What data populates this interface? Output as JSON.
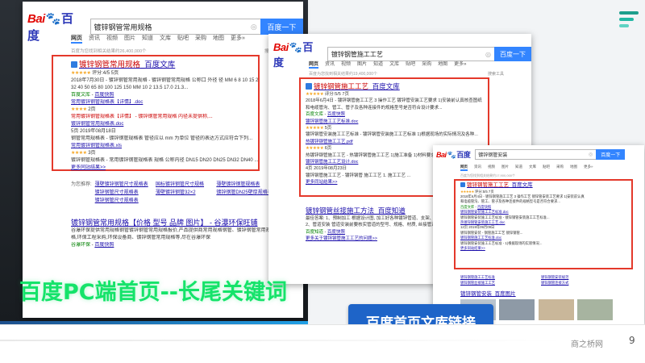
{
  "slide": {
    "caption_main": "百度PC端首页--长尾关键词",
    "caption_button": "百度首页文库链接",
    "footer_brand": "商之桥网",
    "page_number": "9",
    "colors": {
      "accent_green": "#15e36a",
      "accent_blue": "#1e64c8",
      "highlight_red": "#e4392b",
      "baidu_blue": "#3385ff"
    }
  },
  "baidu": {
    "logo_left": "Bai",
    "logo_paw": "🐾",
    "logo_right": "百度",
    "search_button": "百度一下",
    "camera_icon": "camera-icon",
    "tabs": [
      "网页",
      "资讯",
      "视频",
      "图片",
      "知道",
      "文库",
      "贴吧",
      "采购",
      "地图",
      "更多»"
    ],
    "search_tools": "搜索工具"
  },
  "panel1": {
    "query": "镀锌钢管常用规格",
    "result_count": "百度为您找到相关结果约26,400,000个",
    "r1": {
      "title_kw": "镀锌钢管常用规格",
      "title_suffix": "_百度文库",
      "rating": "评分:4/5 5页",
      "desc1": "2018年7月30日 - 镀锌钢管常用规格 - 镀锌钢管常用规格 公称口 外径 径 MM 6 8 10 15 20 25",
      "desc2": "32 40 50 65 80 100 125 150 MM 10 2 13.5 17.0 21.3...",
      "source": "百度文库",
      "snapshot": "百度快照",
      "sub1": "常用镀锌钢管规格表【详情】.doc",
      "sub1_meta": "2页",
      "sub1_desc": "常用镀锌钢管规格表【详情】 - 镀锌钢管常用规格 内径未提供称,...",
      "sub2": "镀锌钢管常用规格表.doc",
      "sub2_meta": "5页 2019年08月18日",
      "sub2_desc": "钢管常用规格表 - 镀锌钢管规格表 管径应以 mm 为单位 管径的表达方式应符合下列...",
      "sub3": "常用镀锌钢管规格表.xls",
      "sub3_meta": "3页",
      "sub3_desc": "镀锌钢管规格表 - 常用镀锌钢管规格表 规格 公称内径 DN15 DN20 DN25 DN32 DN40 ...",
      "more": "更多同站结果>>"
    },
    "related_label": "为您推荐:",
    "related": [
      "薄壁镀锌钢管尺寸规格表",
      "国标镀锌钢管尺寸规格",
      "薄壁镀锌钢管规格表",
      "镀锌钢管尺寸规格表",
      "薄壁镀锌钢管32×2",
      "镀锌钢管DN25壁厚规格表",
      "镀锌钢管尺寸规格表"
    ],
    "r2": {
      "title": "镀锌钢管常用规格【价格 型号 品牌 图片】 - 谷瀑环保旺铺",
      "desc1": "谷瀑环保提供常用规格钢管镀锌钢管常用规格报价,产品提供商常用规格钢管、镀锌钢管常用规格",
      "desc2": "格,环保工程采购,环保设备商、镀锌钢管常用规格等,尽在谷瀑环保",
      "source": "谷瀑环保",
      "snapshot": "百度快照"
    }
  },
  "panel2": {
    "query": "镀锌钢管施工工艺",
    "result_count": "百度为您找到相关结果约19,400,000个",
    "r1": {
      "title_kw": "镀锌钢管施工工艺",
      "title_suffix": "_百度文库",
      "rating": "评分:5/5 7页",
      "desc1": "2018年6月4日 - 镀锌钢管施工工艺 3 操作工艺 镀锌管安装工艺要求 1)安装前认真核查图纸",
      "desc2": "和电缆管沟、管工、管子及各种连接件的规格型号是否符合设计要求...",
      "source": "百度文库",
      "snapshot": "百度快照",
      "sub1": "镀锌钢管施工工艺标准.doc",
      "sub1_meta": "5页",
      "sub1_desc": "镀锌钢管安装施工工艺标准 - 镀锌钢管安装施工工艺标准 1)根据现场的实际情况及各种...",
      "sub2": "热镀锌钢管施工工艺.pdf",
      "sub2_meta": "6页",
      "sub2_desc": "热镀锌钢管施工工艺 - 热镀锌钢管施工工艺 1)施工准备 1)材料要求 a 镀锌钢管...",
      "sub3": "镀锌钢管施工工艺设计.doc",
      "sub3_meta": "4页 2019年08月23日",
      "sub3_desc": "镀锌钢管施工工艺 - 镀锌钢管 施工工艺 1. 施工工艺 ...",
      "more": "更多同站结果>>"
    },
    "r2": {
      "title": "镀锌钢管丝接施工方法_百度知道",
      "desc1": "最佳答案: 1、预制加工 根据设计图, 加工好各种镀锌管道、支架、吊架...",
      "desc2": "2、管道安装 管道安装前要核实管道的型号、规格、材质, 丝接管道...",
      "source": "百度知道",
      "snapshot": "百度快照",
      "more": "更多关于镀锌钢管施工工艺的问题>>"
    }
  },
  "panel3": {
    "query": "镀锌钢管安装",
    "result_count": "百度为您找到相关结果约17,900,000个",
    "r1": {
      "title_kw": "镀锌钢管施工工艺",
      "title_suffix": "_百度文库",
      "rating": "评分:5/5 7页",
      "desc1": "2018年6月4日 - 镀锌钢管施工工艺 3 操作工艺 镀锌管安装工艺要求 1)安装前认真",
      "desc2": "和电缆管沟、管工、管子及各种连接件的规格型号是否符合要求...",
      "source": "百度文库",
      "snapshot": "百度快照",
      "sub1": "镀锌钢管安装施工工艺标准.doc",
      "sub1_desc": "镀锌钢管安装施工工艺标准 - 镀锌钢管安装施工工艺标准...",
      "sub2": "热镀锌钢管安装施工工艺.doc",
      "sub2_meta": "12页 2019年09月09日",
      "sub2_desc": "镀锌钢管安装 - 钢管施工工艺 镀锌钢管...",
      "sub3": "镀锌钢管施工工艺标准.doc",
      "sub3_desc": "镀锌钢管安装施工工艺标准 - 1)根据现场的实际情况...",
      "more": "更多同站结果>>"
    },
    "related": [
      "镀锌钢管施工工艺标准",
      "镀锌钢管安装规范",
      "镀锌钢管丝接施工工艺",
      "镀锌钢管连接方式"
    ],
    "r2_title": "镀锌钢管安装_百度图片"
  }
}
